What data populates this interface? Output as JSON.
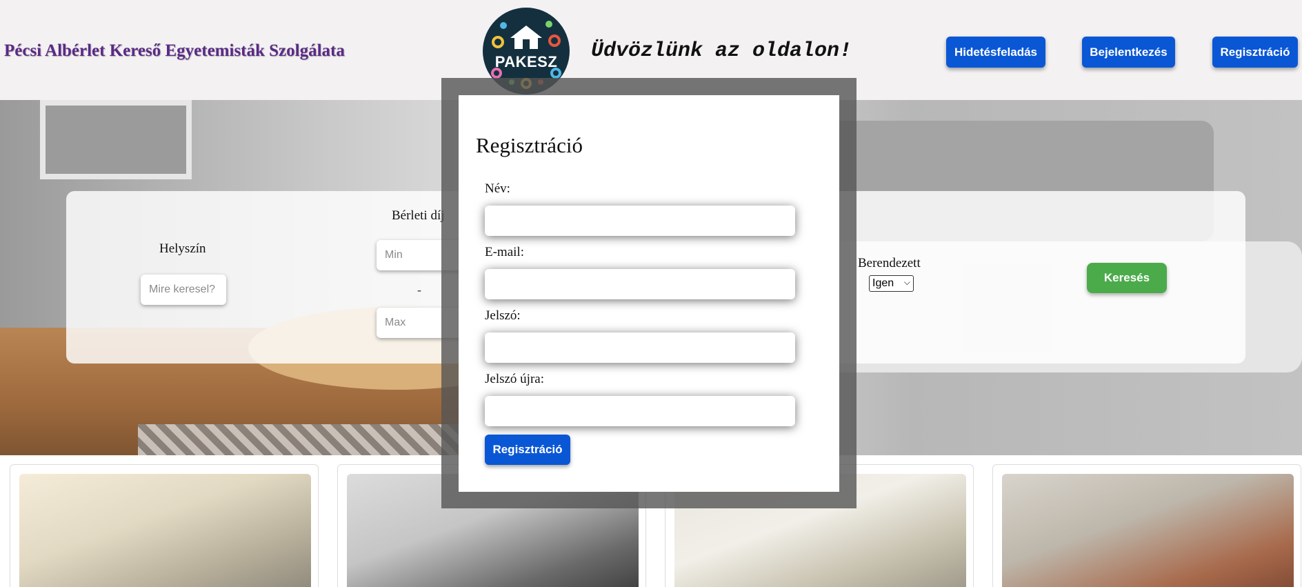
{
  "header": {
    "site_title": "Pécsi Albérlet Kereső Egyetemisták Szolgálata",
    "logo_text": "PAKESZ",
    "welcome": "Üdvözlünk az oldalon!",
    "buttons": {
      "post_ad": "Hidetésfeladás",
      "login": "Bejelentkezés",
      "register": "Regisztráció"
    }
  },
  "search": {
    "location_label": "Helyszín",
    "location_placeholder": "Mire keresel?",
    "rent_label": "Bérleti díj",
    "min_placeholder": "Min",
    "max_placeholder": "Max",
    "range_separator": "-",
    "furnished_label": "Berendezett",
    "furnished_selected": "Igen",
    "search_button": "Keresés"
  },
  "modal": {
    "title": "Regisztráció",
    "fields": [
      {
        "label": "Név:",
        "value": ""
      },
      {
        "label": "E-mail:",
        "value": ""
      },
      {
        "label": "Jelszó:",
        "value": ""
      },
      {
        "label": "Jelszó újra:",
        "value": ""
      }
    ],
    "submit": "Regisztráció"
  },
  "colors": {
    "primary_button": "#0a57d6",
    "search_button": "#4bab4b",
    "title_purple": "#5a2a86"
  }
}
